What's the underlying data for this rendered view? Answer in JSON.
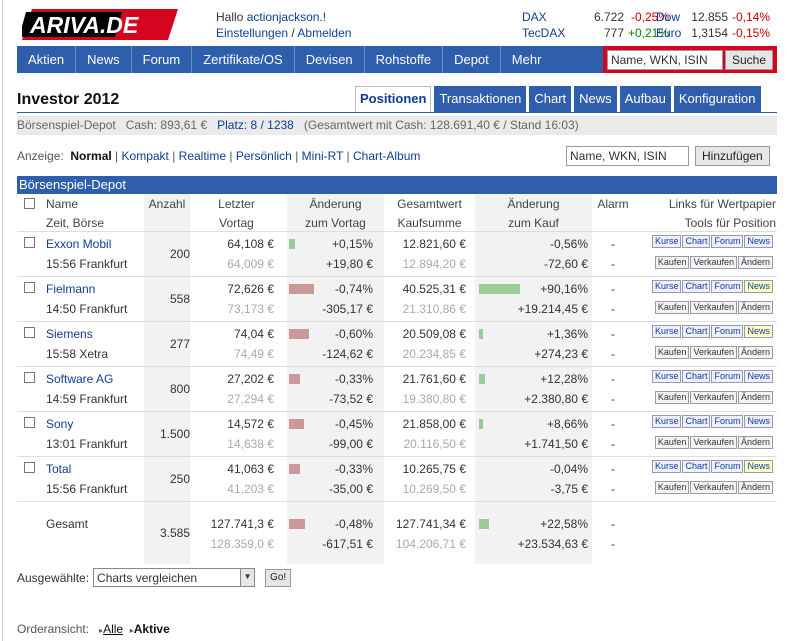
{
  "header": {
    "logo_text": "ARIVA.DE",
    "greeting_prefix": "Hallo",
    "user": "actionjackson.!",
    "settings_link": "Einstellungen",
    "separator": "/",
    "logout_link": "Abmelden"
  },
  "indices": [
    {
      "name": "DAX",
      "value": "6.722",
      "change": "-0,25%"
    },
    {
      "name": "TecDAX",
      "value": "777",
      "change": "+0,21%"
    },
    {
      "name": "Dow",
      "value": "12.855",
      "change": "-0,14%"
    },
    {
      "name": "Euro",
      "value": "1,3154",
      "change": "-0,15%"
    }
  ],
  "nav": {
    "items": [
      "Aktien",
      "News",
      "Forum",
      "Zertifikate/OS",
      "Devisen",
      "Rohstoffe",
      "Depot",
      "Mehr"
    ],
    "search_value": "Name, WKN, ISIN",
    "search_button": "Suche"
  },
  "page": {
    "title": "Investor 2012",
    "tabs": [
      "Positionen",
      "Transaktionen",
      "Chart",
      "News",
      "Aufbau",
      "Konfiguration"
    ],
    "active_tab": "Positionen",
    "sub_left": "Börsenspiel-Depot   Cash: 893,61 €",
    "sub_place": "Platz: 8 / 1238",
    "sub_right": "(Gesamtwert mit Cash: 128.691,40 € / Stand 16:03)"
  },
  "views": {
    "label": "Anzeige:",
    "current": "Normal",
    "links": [
      "Kompakt",
      "Realtime",
      "Persönlich",
      "Mini-RT",
      "Chart-Album"
    ],
    "add_value": "Name, WKN, ISIN",
    "add_button": "Hinzufügen"
  },
  "table": {
    "title": "Börsenspiel-Depot",
    "headers": {
      "name": "Name",
      "zeit": "Zeit, Börse",
      "anzahl": "Anzahl",
      "letzter": "Letzter",
      "vortag": "Vortag",
      "aend": "Änderung",
      "zumvortag": "zum Vortag",
      "gesamt": "Gesamtwert",
      "kaufsumme": "Kaufsumme",
      "aend2": "Änderung",
      "zumkauf": "zum Kauf",
      "alarm": "Alarm",
      "links": "Links für Wertpapier",
      "tools": "Tools für Position"
    },
    "rows": [
      {
        "name": "Exxon Mobil",
        "time": "15:56 Frankfurt",
        "qty": "200",
        "last": "64,108 €",
        "prev": "64,009 €",
        "chg_pct": "+0,15%",
        "chg_abs": "+19,80 €",
        "chg_sign": "pos",
        "total": "12.821,60 €",
        "buy": "12.894,20 €",
        "buy_pct": "-0,56%",
        "buy_abs": "-72,60 €",
        "buy_sign": "neg",
        "alarm1": "-",
        "alarm2": "-",
        "news_hl": false,
        "day_bar": 0.15,
        "buy_bar": 0.0
      },
      {
        "name": "Fielmann",
        "time": "14:50 Frankfurt",
        "qty": "558",
        "last": "72,626 €",
        "prev": "73,173 €",
        "chg_pct": "-0,74%",
        "chg_abs": "-305,17 €",
        "chg_sign": "neg",
        "total": "40.525,31 €",
        "buy": "21.310,86 €",
        "buy_pct": "+90,16%",
        "buy_abs": "+19.214,45 €",
        "buy_sign": "pos",
        "alarm1": "-",
        "alarm2": "-",
        "news_hl": true,
        "day_bar": 0.74,
        "buy_bar": 90.16
      },
      {
        "name": "Siemens",
        "time": "15:58 Xetra",
        "qty": "277",
        "last": "74,04 €",
        "prev": "74,49 €",
        "chg_pct": "-0,60%",
        "chg_abs": "-124,62 €",
        "chg_sign": "neg",
        "total": "20.509,08 €",
        "buy": "20.234,85 €",
        "buy_pct": "+1,36%",
        "buy_abs": "+274,23 €",
        "buy_sign": "pos",
        "alarm1": "-",
        "alarm2": "-",
        "news_hl": true,
        "day_bar": 0.6,
        "buy_bar": 1.36
      },
      {
        "name": "Software AG",
        "time": "14:59 Frankfurt",
        "qty": "800",
        "last": "27,202 €",
        "prev": "27,294 €",
        "chg_pct": "-0,33%",
        "chg_abs": "-73,52 €",
        "chg_sign": "neg",
        "total": "21.761,60 €",
        "buy": "19.380,80 €",
        "buy_pct": "+12,28%",
        "buy_abs": "+2.380,80 €",
        "buy_sign": "pos",
        "alarm1": "-",
        "alarm2": "-",
        "news_hl": false,
        "day_bar": 0.33,
        "buy_bar": 12.28
      },
      {
        "name": "Sony",
        "time": "13:01 Frankfurt",
        "qty": "1.500",
        "last": "14,572 €",
        "prev": "14,638 €",
        "chg_pct": "-0,45%",
        "chg_abs": "-99,00 €",
        "chg_sign": "neg",
        "total": "21.858,00 €",
        "buy": "20.116,50 €",
        "buy_pct": "+8,66%",
        "buy_abs": "+1.741,50 €",
        "buy_sign": "pos",
        "alarm1": "-",
        "alarm2": "-",
        "news_hl": false,
        "day_bar": 0.45,
        "buy_bar": 8.66
      },
      {
        "name": "Total",
        "time": "15:56 Frankfurt",
        "qty": "250",
        "last": "41,063 €",
        "prev": "41,203 €",
        "chg_pct": "-0,33%",
        "chg_abs": "-35,00 €",
        "chg_sign": "neg",
        "total": "10.265,75 €",
        "buy": "10.269,50 €",
        "buy_pct": "-0,04%",
        "buy_abs": "-3,75 €",
        "buy_sign": "neg",
        "alarm1": "-",
        "alarm2": "-",
        "news_hl": true,
        "day_bar": 0.33,
        "buy_bar": 0.0
      }
    ],
    "total": {
      "label": "Gesamt",
      "qty": "3.585",
      "last": "127.741,3 €",
      "prev": "128.359,0 €",
      "chg_pct": "-0,48%",
      "chg_abs": "-617,51 €",
      "total": "127.741,34 €",
      "buy": "104.206,71 €",
      "buy_pct": "+22,58%",
      "buy_abs": "+23.534,63 €",
      "alarm1": "-",
      "alarm2": "-",
      "day_bar": 0.48,
      "buy_bar": 22.58
    },
    "mini_buttons": {
      "kurse": "Kurse",
      "chart": "Chart",
      "forum": "Forum",
      "news": "News",
      "kaufen": "Kaufen",
      "verkaufen": "Verkaufen",
      "aendern": "Ändern"
    }
  },
  "footer": {
    "selected_label": "Ausgewählte:",
    "selected_value": "Charts vergleichen",
    "go_button": "Go!",
    "order_label": "Orderansicht:",
    "order_all": "Alle",
    "order_active": "Aktive"
  },
  "colors": {
    "nav_blue": "#2e5eac",
    "brand_red": "#d6041f",
    "negative": "#cc0000",
    "positive": "#008a00"
  }
}
